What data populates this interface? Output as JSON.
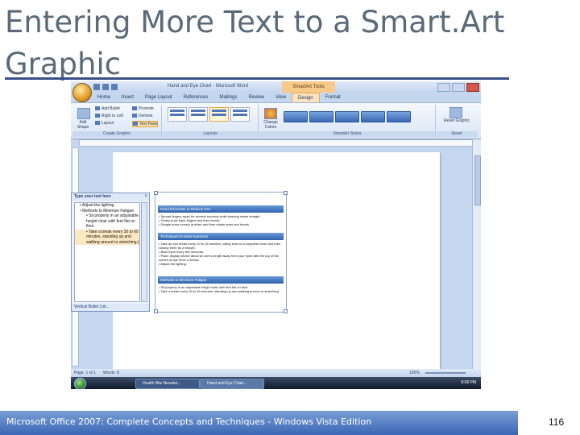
{
  "slide": {
    "title_line1": "Entering More Text to a Smart.Art",
    "title_line2": "Graphic",
    "footer": "Microsoft Office 2007: Complete Concepts and Techniques - Windows Vista Edition",
    "page_number": "116",
    "accent_color": "#3a4f88"
  },
  "word": {
    "window_title": "Hand and Eye Chart - Microsoft Word",
    "context_tab": "SmartArt Tools",
    "tabs": [
      "Home",
      "Insert",
      "Page Layout",
      "References",
      "Mailings",
      "Review",
      "View",
      "Design",
      "Format"
    ],
    "active_tab": "Design",
    "ribbon": {
      "add_shape": "Add Shape",
      "add_bullet": "Add Bullet",
      "right_to_left": "Right to Left",
      "layout": "Layout",
      "promote": "Promote",
      "demote": "Demote",
      "text_pane": "Text Pane",
      "group_create": "Create Graphic",
      "group_layouts": "Layouts",
      "change_colors": "Change Colors",
      "group_styles": "SmartArt Styles",
      "reset_graphic": "Reset Graphic",
      "group_reset": "Reset"
    },
    "text_pane": {
      "title": "Type your text here",
      "close": "×",
      "lines": [
        "• Adjust the lighting.",
        "• Methods to Minimize Fatigue",
        "• Sit properly in an adjustable height chair with feet flat on floor.",
        "• Take a break every 30 to 60 minutes, standing up and walking around or stretching.|"
      ],
      "footer": "Vertical Bullet List..."
    },
    "smartart": {
      "sections": [
        {
          "heading": "Hand Exercises to Reduce RSI",
          "bullets": [
            "• Spread fingers apart for several seconds while keeping wrists straight.",
            "• Gently push back fingers and then thumb.",
            "• Dangle arms loosely at sides and then shake arms and hands."
          ]
        },
        {
          "heading": "Techniques to Ease Eyestrain",
          "bullets": [
            "• Take an eye break every 10 to 15 minutes, rolling eyes in a complete circle and then closing them for a minute.",
            "• Blink eyes every five seconds.",
            "• Place display device about an arm's length away from your eyes with the top of the screen at eye level or below.",
            "• Adjust the lighting."
          ]
        },
        {
          "heading": "Methods to Minimize Fatigue",
          "bullets": [
            "• Sit properly in an adjustable height chair with feet flat on floor.",
            "• Take a break every 30 to 60 minutes, standing up and walking around or stretching."
          ]
        }
      ]
    },
    "status": {
      "page": "Page: 1 of 1",
      "words": "Words: 8",
      "zoom": "100%"
    },
    "taskbar": {
      "items": [
        "Health Bits Newslet...",
        "Hand and Eye Chart..."
      ],
      "clock": "8:08 PM"
    }
  }
}
